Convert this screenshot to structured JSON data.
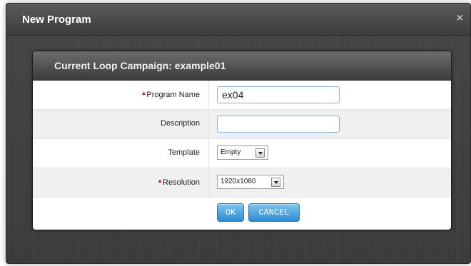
{
  "dialog": {
    "title": "New Program",
    "close_glyph": "×"
  },
  "panel": {
    "heading": "Current Loop Campaign: example01"
  },
  "form": {
    "required_marker": "▲",
    "program_name": {
      "label": "Program Name",
      "value": "ex04",
      "required": true
    },
    "description": {
      "label": "Description",
      "value": ""
    },
    "template": {
      "label": "Template",
      "selected": "Empty"
    },
    "resolution": {
      "label": "Resolution",
      "selected": "1920x1080",
      "required": true
    }
  },
  "buttons": {
    "ok": "OK",
    "cancel": "CANCEL"
  },
  "colors": {
    "required": "#d4141a",
    "button": "#2d8bd0",
    "input_border": "#8fb1cf"
  }
}
